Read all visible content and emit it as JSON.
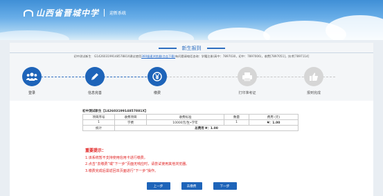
{
  "header": {
    "school_name": "山西省晋城中学",
    "system_name": "迎新系统"
  },
  "section": {
    "title": "新生报到"
  },
  "notice": {
    "prefix": "初中测试新生　G142603199148578​81X建议使用",
    "link": "360极速浏览器(点击下载)",
    "suffix": "有问题请电话咨询：学籍注册(高中：7897030，初中：7897006)，收费[7897051]，技术[7897114]"
  },
  "steps": [
    {
      "label": "登录",
      "icon": "team-icon",
      "state": "done"
    },
    {
      "label": "信息完善",
      "icon": "pencil-icon",
      "state": "done"
    },
    {
      "label": "缴费",
      "icon": "yuan-icon",
      "state": "current"
    },
    {
      "label": "打印准考证",
      "icon": "printer-icon",
      "state": "todo"
    },
    {
      "label": "报到完成",
      "icon": "thumbs-up-icon",
      "state": "todo"
    }
  ],
  "student_info": "初中测试新生【142603199148578​81X】",
  "table": {
    "headers": [
      "项目序号",
      "收费项目",
      "收费标准",
      "数量",
      "费用 (元)"
    ],
    "rows": [
      [
        "1",
        "学费",
        "10000元/生•学年",
        "1",
        "¥：1.00"
      ]
    ],
    "total_label": "统计",
    "total_value": "总费用 ¥：1.00"
  },
  "tips": {
    "title": "重要提示：",
    "lines": [
      "1.该系统暂不支持使用信用卡进行缴费。",
      "2.点击“去缴费”或“下一步”页面无响应时，请尝试使用其他浏览器。",
      "3.缴费完成后需返回本页面进行“下一步”操作。"
    ]
  },
  "buttons": {
    "prev": "上一步",
    "pay": "去缴费",
    "next": "下一步"
  },
  "colors": {
    "primary": "#1e64b9",
    "warning": "#e02020",
    "inactive": "#d6d6d6"
  }
}
